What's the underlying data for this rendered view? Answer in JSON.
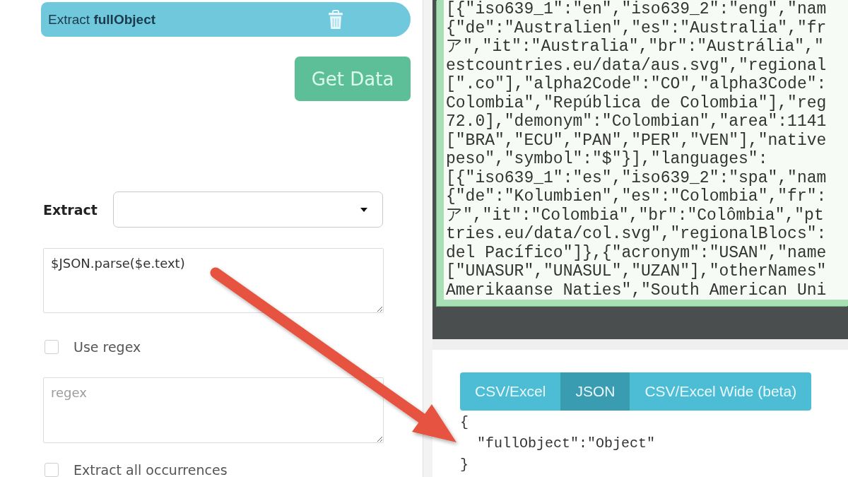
{
  "extractor": {
    "label": "Extract **fullObject**"
  },
  "get_data_button": {
    "label": "Get Data"
  },
  "extract_select": {
    "label": "Extract"
  },
  "expression_field": {
    "value": "$JSON.parse($e.text)"
  },
  "use_regex": {
    "label": "Use regex",
    "checked": false
  },
  "regex_field": {
    "placeholder": "regex"
  },
  "extract_all": {
    "label": "Extract all occurrences",
    "checked": false
  },
  "response_code": {
    "lines": [
      "[{\"iso639_1\":\"en\",\"iso639_2\":\"eng\",\"nam",
      "{\"de\":\"Australien\",\"es\":\"Australia\",\"fr",
      "ア\",\"it\":\"Australia\",\"br\":\"Austrália\",\"",
      "estcountries.eu/data/aus.svg\",\"regional",
      "[\".co\"],\"alpha2Code\":\"CO\",\"alpha3Code\":",
      "Colombia\",\"República de Colombia\"],\"reg",
      "72.0],\"demonym\":\"Colombian\",\"area\":1141",
      "[\"BRA\",\"ECU\",\"PAN\",\"PER\",\"VEN\"],\"native",
      "peso\",\"symbol\":\"$\"}],\"languages\":",
      "[{\"iso639_1\":\"es\",\"iso639_2\":\"spa\",\"nam",
      "{\"de\":\"Kolumbien\",\"es\":\"Colombia\",\"fr\":",
      "ア\",\"it\":\"Colombia\",\"br\":\"Colômbia\",\"pt",
      "tries.eu/data/col.svg\",\"regionalBlocs\":",
      "del Pacífico\"]},{\"acronym\":\"USAN\",\"name",
      "[\"UNASUR\",\"UNASUL\",\"UZAN\"],\"otherNames\"",
      "Amerikaanse Naties\",\"South American Uni"
    ]
  },
  "output_tabs": [
    {
      "label": "CSV/Excel",
      "selected": false
    },
    {
      "label": "JSON",
      "selected": true
    },
    {
      "label": "CSV/Excel Wide (beta)",
      "selected": false
    }
  ],
  "output": {
    "lines": [
      "{",
      "  \"fullObject\":\"Object\"",
      "}"
    ]
  }
}
